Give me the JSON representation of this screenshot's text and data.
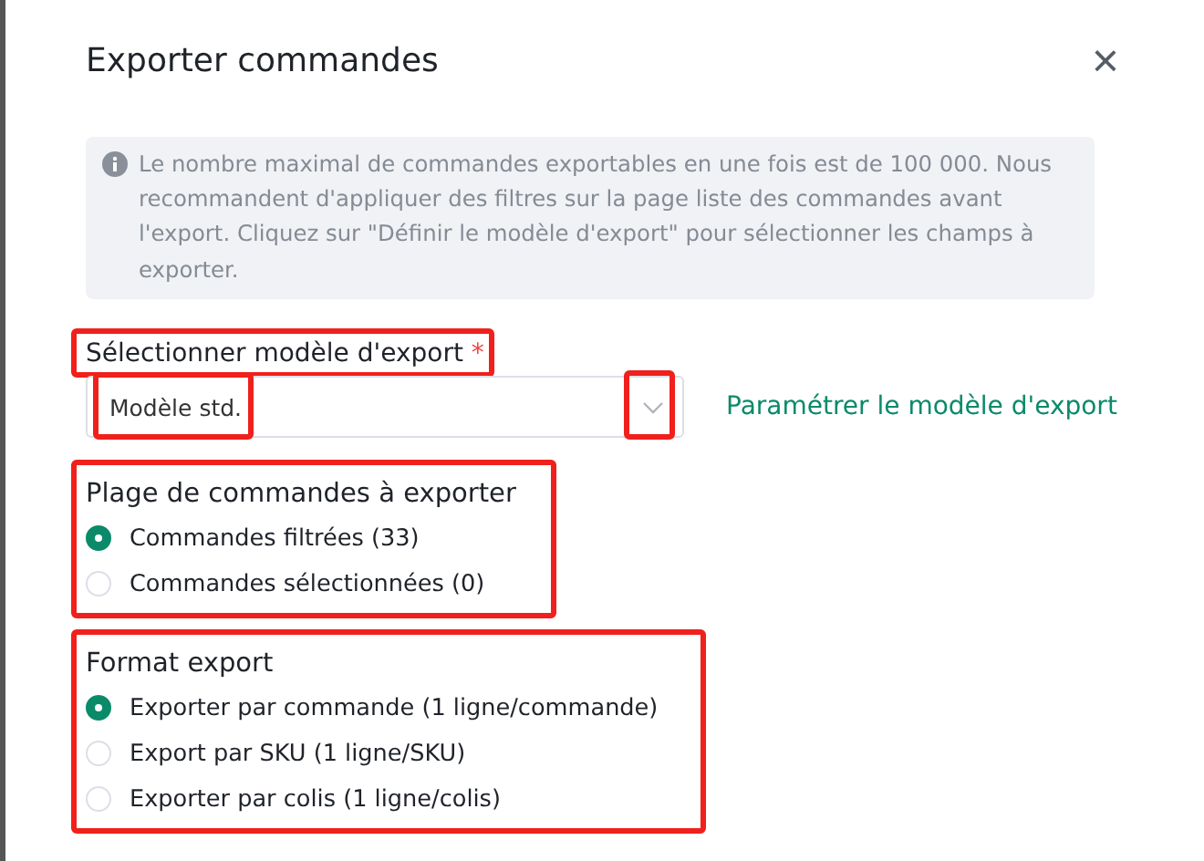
{
  "dialog": {
    "title": "Exporter commandes",
    "close": "×"
  },
  "notice": {
    "text": "Le nombre maximal de commandes exportables en une fois est de 100 000. Nous recommandent d'appliquer des filtres sur la page liste des commandes avant l'export. Cliquez sur \"Définir le modèle d'export\" pour sélectionner les champs à exporter."
  },
  "template": {
    "label": "Sélectionner modèle d'export",
    "required_mark": "*",
    "label_highlighted": true,
    "value": "Modèle std.",
    "value_highlighted": true,
    "caret_highlighted": true,
    "link": "Paramétrer le modèle d'export"
  },
  "groups": [
    {
      "title": "Plage de commandes à exporter",
      "highlighted": true,
      "options": [
        {
          "label": "Commandes filtrées (33)",
          "selected": true
        },
        {
          "label": "Commandes sélectionnées (0)",
          "selected": false
        }
      ]
    },
    {
      "title": "Format export",
      "highlighted": true,
      "options": [
        {
          "label": "Exporter par commande (1 ligne/commande)",
          "selected": true
        },
        {
          "label": "Export par SKU (1 ligne/SKU)",
          "selected": false
        },
        {
          "label": "Exporter par colis (1 ligne/colis)",
          "selected": false
        }
      ]
    }
  ]
}
